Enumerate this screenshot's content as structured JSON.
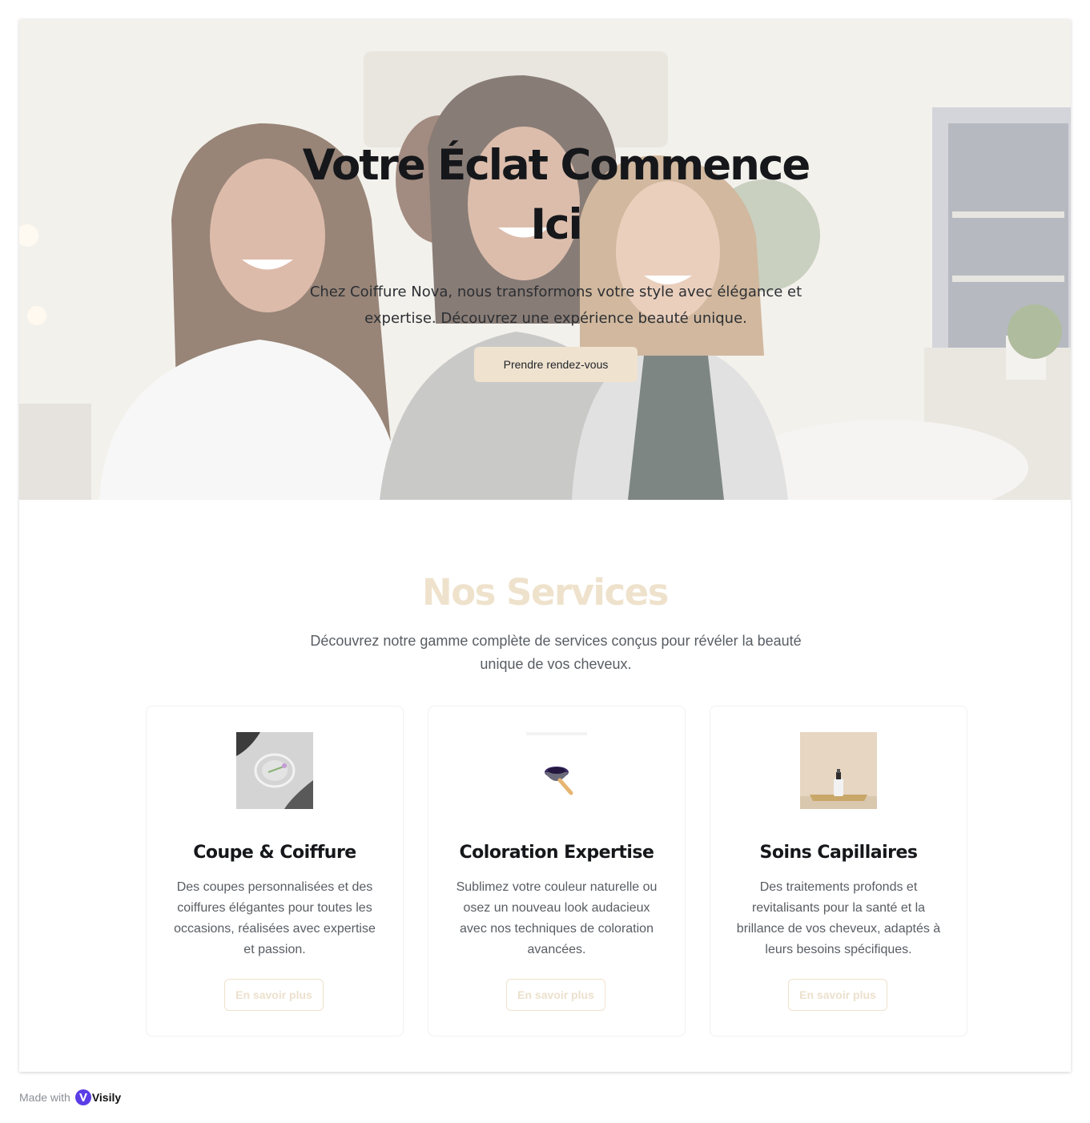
{
  "hero": {
    "title": "Votre Éclat Commence Ici",
    "subtitle": "Chez Coiffure Nova, nous transformons votre style avec élégance et expertise. Découvrez une expérience beauté unique.",
    "cta_label": "Prendre rendez-vous",
    "image_alt": "three smiling women in a hair salon"
  },
  "services": {
    "title": "Nos Services",
    "subtitle": "Découvrez notre gamme complète de services conçus pour révéler la beauté unique de vos cheveux.",
    "cards": [
      {
        "title": "Coupe & Coiffure",
        "description": "Des coupes personnalisées et des coiffures élégantes pour toutes les occasions, réalisées avec expertise et passion.",
        "button_label": "En savoir plus",
        "icon": "glass-bowl-image"
      },
      {
        "title": "Coloration Expertise",
        "description": "Sublimez votre couleur naturelle ou osez un nouveau look audacieux avec nos techniques de coloration avancées.",
        "button_label": "En savoir plus",
        "icon": "color-bowl-brush-image"
      },
      {
        "title": "Soins Capillaires",
        "description": "Des traitements profonds et revitalisants pour la santé et la brillance de vos cheveux, adaptés à leurs besoins spécifiques.",
        "button_label": "En savoir plus",
        "icon": "serum-bottle-image"
      }
    ]
  },
  "footer": {
    "made_with": "Made with",
    "brand": "Visily"
  },
  "colors": {
    "accent": "#efe2cf",
    "services_title": "#efe2cc",
    "text_dark": "#15171a",
    "text_muted": "#585d63"
  }
}
